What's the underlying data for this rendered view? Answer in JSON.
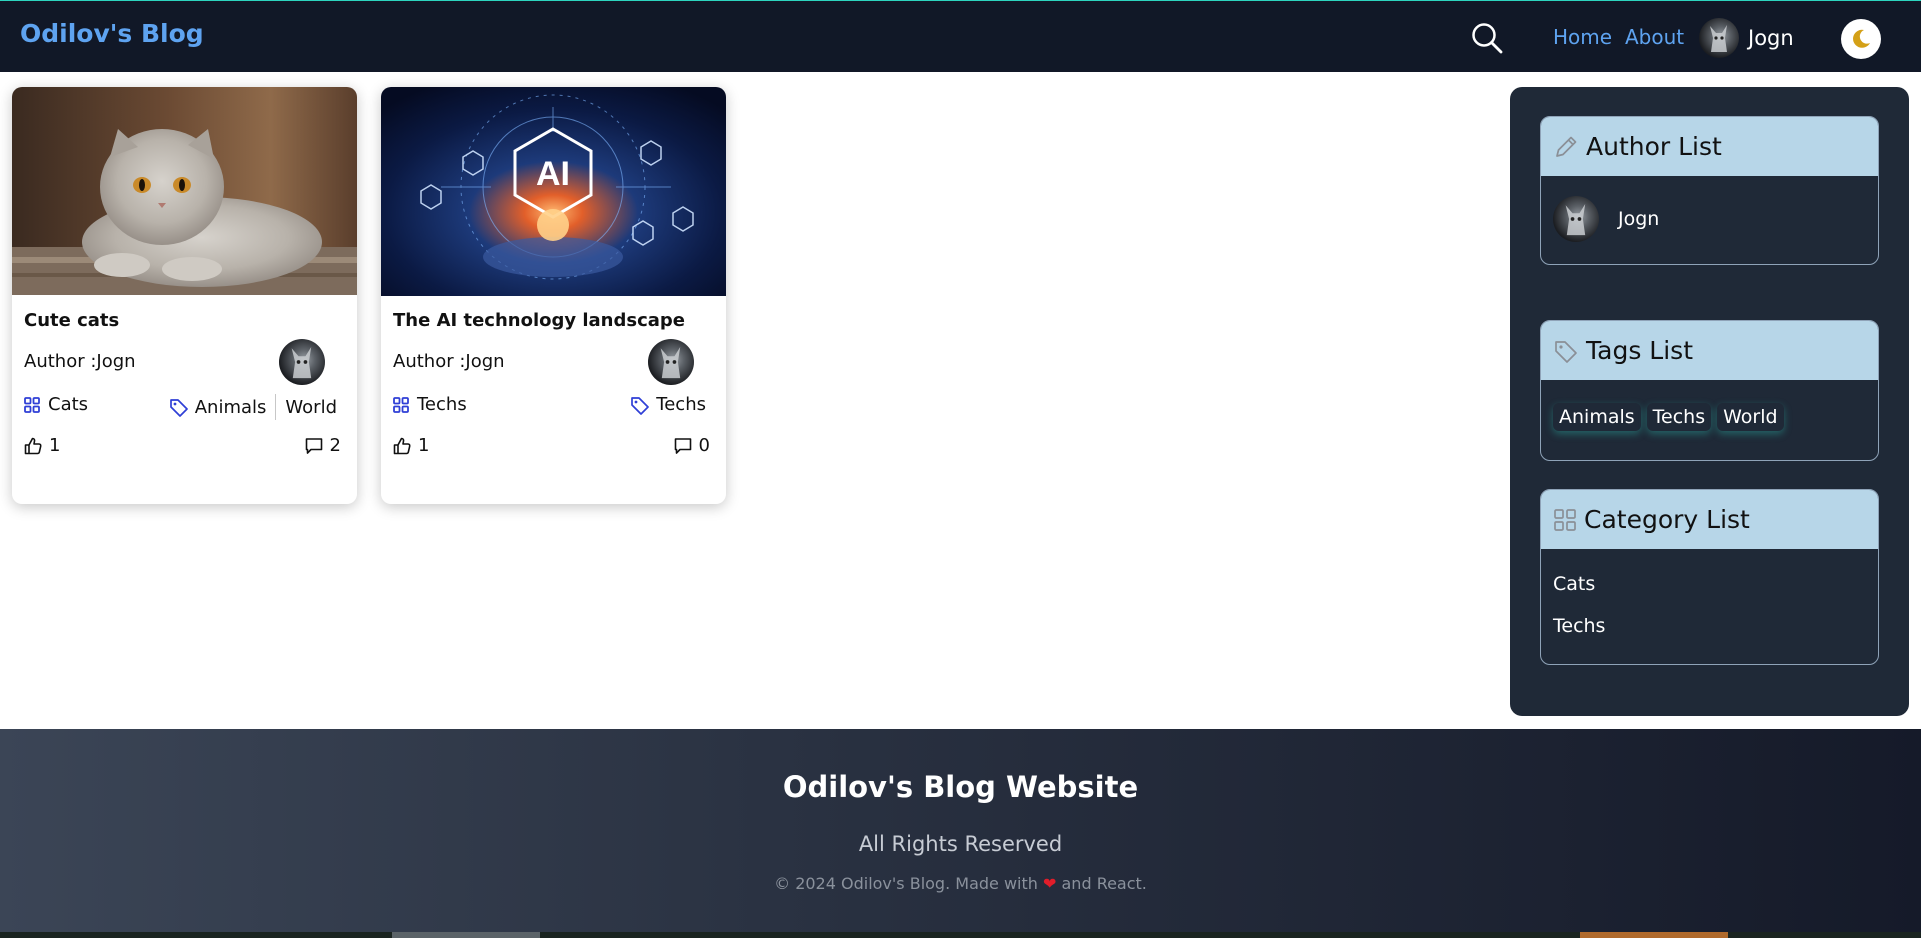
{
  "brand": "Odilov's Blog",
  "nav": {
    "home": "Home",
    "about": "About",
    "username": "Jogn"
  },
  "posts": [
    {
      "title": "Cute cats",
      "author": "Author :Jogn",
      "category": "Cats",
      "tags": [
        "Animals",
        "World"
      ],
      "likes": "1",
      "comments": "2"
    },
    {
      "title": "The AI technology landscape",
      "author": "Author :Jogn",
      "category": "Techs",
      "tags": [
        "Techs"
      ],
      "likes": "1",
      "comments": "0"
    }
  ],
  "sidebar": {
    "author_title": "Author List",
    "authors": [
      "Jogn"
    ],
    "tags_title": "Tags List",
    "tags": [
      "Animals",
      "Techs",
      "World"
    ],
    "category_title": "Category List",
    "categories": [
      "Cats",
      "Techs"
    ]
  },
  "footer": {
    "title": "Odilov's Blog Website",
    "rights": "All Rights Reserved",
    "copy_before": "© 2024 Odilov's Blog. Made with",
    "heart": "❤",
    "copy_after": "and React."
  },
  "image_text": "AI",
  "colors": {
    "navbar": "#111827",
    "brand": "#5ea3f0",
    "sidebar": "#1f2937",
    "panel_header": "#b7d6e8",
    "icon_blue": "#2f3fd6",
    "moon": "#d4a017"
  }
}
